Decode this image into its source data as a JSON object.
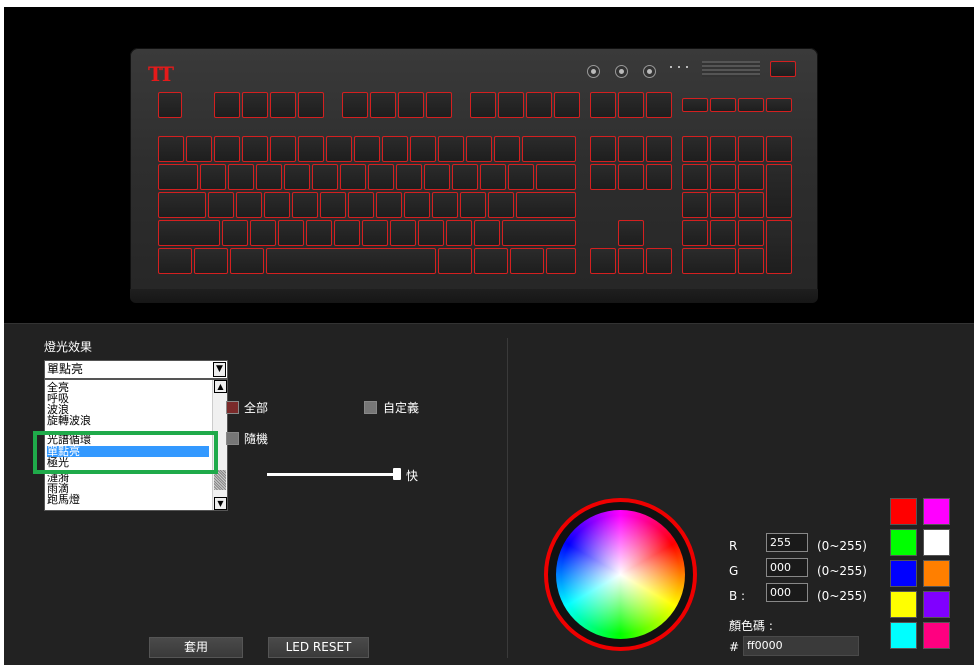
{
  "keyboard": {
    "brand_logo": "TT"
  },
  "effect_panel": {
    "title": "燈光效果",
    "selected_effect": "單點亮",
    "options": [
      "全亮",
      "呼吸",
      "波浪",
      "旋轉波浪",
      "光譜循環",
      "單點亮",
      "極光",
      "漣漪",
      "雨滴",
      "跑馬燈"
    ],
    "selected_index": 5,
    "all_label": "全部",
    "random_label": "隨機",
    "custom_label": "自定義",
    "speed_fast_label": "快",
    "speed_level": 1.0
  },
  "buttons": {
    "apply": "套用",
    "led_reset": "LED RESET"
  },
  "color": {
    "r_label": "R",
    "g_label": "G",
    "b_label": "B :",
    "r_value": "255",
    "g_value": "000",
    "b_value": "000",
    "range_hint": "(0~255)",
    "hex_title": "顏色碼 :",
    "hex_prefix": "#",
    "hex_value": "ff0000",
    "swatches": [
      "#ff0000",
      "#ff00ff",
      "#00ff00",
      "#ffffff",
      "#0000ff",
      "#ff7f00",
      "#ffff00",
      "#8000ff",
      "#00ffff",
      "#ff0080"
    ]
  },
  "colors": {
    "accent_red": "#e00000",
    "highlight_green": "#1faa4a",
    "selection_blue": "#3399ff"
  }
}
